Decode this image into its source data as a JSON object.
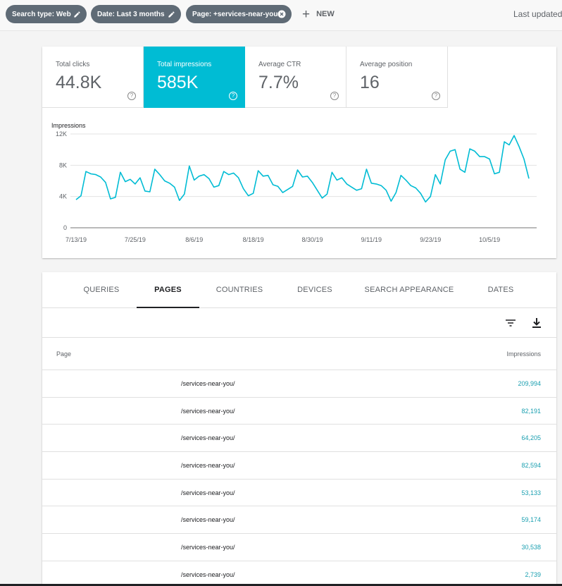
{
  "filters": {
    "chips": [
      {
        "label": "Search type: Web",
        "icon": "pencil-icon"
      },
      {
        "label": "Date: Last 3 months",
        "icon": "pencil-icon"
      },
      {
        "label": "Page: +services-near-you",
        "icon": "close-circle-icon"
      }
    ],
    "new_label": "NEW",
    "last_updated": "Last updated"
  },
  "metrics": [
    {
      "label": "Total clicks",
      "value": "44.8K",
      "active": false
    },
    {
      "label": "Total impressions",
      "value": "585K",
      "active": true
    },
    {
      "label": "Average CTR",
      "value": "7.7%",
      "active": false
    },
    {
      "label": "Average position",
      "value": "16",
      "active": false
    }
  ],
  "chart_data": {
    "type": "line",
    "ylabel": "Impressions",
    "y_tick_labels": [
      "0",
      "4K",
      "8K",
      "12K"
    ],
    "y_ticks": [
      0,
      4000,
      8000,
      12000
    ],
    "ylim": [
      0,
      12000
    ],
    "x_tick_labels": [
      "7/13/19",
      "7/25/19",
      "8/6/19",
      "8/18/19",
      "8/30/19",
      "9/11/19",
      "9/23/19",
      "10/5/19"
    ],
    "start_date": "7/13/19",
    "grid": true,
    "color": "#00bcd4",
    "series": [
      {
        "values": [
          3600,
          4100,
          7200,
          6900,
          6800,
          6500,
          5800,
          3700,
          3900,
          7100,
          5900,
          6200,
          5600,
          6400,
          4700,
          4600,
          7500,
          6800,
          6000,
          5700,
          5200,
          3500,
          4300,
          7900,
          6100,
          6600,
          6800,
          6300,
          5200,
          5400,
          7200,
          6800,
          7000,
          6400,
          5000,
          4100,
          4400,
          7300,
          6600,
          6700,
          5500,
          5300,
          4500,
          4900,
          5300,
          7400,
          6500,
          6600,
          5800,
          4800,
          3800,
          4300,
          7100,
          6100,
          6400,
          5600,
          5200,
          4800,
          5000,
          7500,
          5700,
          5600,
          5400,
          4800,
          3400,
          4500,
          6700,
          6100,
          5400,
          5100,
          4400,
          3300,
          4000,
          6800,
          5600,
          8700,
          9800,
          10000,
          7500,
          7100,
          10100,
          9800,
          9100,
          9100,
          8800,
          6900,
          7100,
          11000,
          10600,
          11800,
          10400,
          8800,
          6300
        ]
      }
    ]
  },
  "table": {
    "tabs": [
      "QUERIES",
      "PAGES",
      "COUNTRIES",
      "DEVICES",
      "SEARCH APPEARANCE",
      "DATES"
    ],
    "active_tab": "PAGES",
    "columns": [
      "Page",
      "Impressions"
    ],
    "rows": [
      {
        "page": "/services-near-you/",
        "impressions": "209,994"
      },
      {
        "page": "/services-near-you/",
        "impressions": "82,191"
      },
      {
        "page": "/services-near-you/",
        "impressions": "64,205"
      },
      {
        "page": "/services-near-you/",
        "impressions": "82,594"
      },
      {
        "page": "/services-near-you/",
        "impressions": "53,133"
      },
      {
        "page": "/services-near-you/",
        "impressions": "59,174"
      },
      {
        "page": "/services-near-you/",
        "impressions": "30,538"
      },
      {
        "page": "/services-near-you/",
        "impressions": "2,739"
      }
    ]
  }
}
